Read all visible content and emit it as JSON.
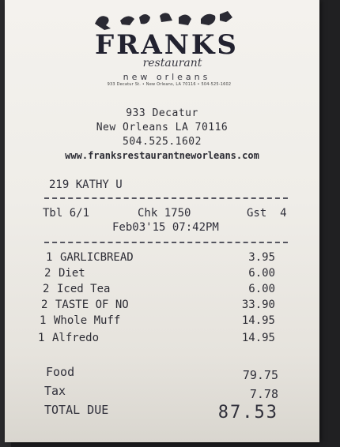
{
  "logo": {
    "name": "FRANKS",
    "sub1": "restaurant",
    "sub2": "new orleans",
    "address_line": "933 Decatur St. • New Orleans, LA 70116 • 504-525-1602"
  },
  "header": {
    "street": "933 Decatur",
    "city": "New Orleans LA 70116",
    "phone": "504.525.1602",
    "website": "www.franksrestaurantneworleans.com"
  },
  "server": "219 KATHY U",
  "ticket": {
    "table": "Tbl 6/1",
    "check": "Chk 1750",
    "guests": "Gst  4",
    "datetime": "Feb03'15 07:42PM"
  },
  "items": [
    {
      "qty": "1",
      "name": "GARLICBREAD",
      "price": "3.95"
    },
    {
      "qty": "2",
      "name": "Diet",
      "price": "6.00"
    },
    {
      "qty": "2",
      "name": "Iced Tea",
      "price": "6.00"
    },
    {
      "qty": "2",
      "name": "TASTE OF NO",
      "price": "33.90"
    },
    {
      "qty": "1",
      "name": "Whole Muff",
      "price": "14.95"
    },
    {
      "qty": "1",
      "name": "Alfredo",
      "price": "14.95"
    }
  ],
  "totals": {
    "food_label": "Food",
    "food": "79.75",
    "tax_label": "Tax",
    "tax": "7.78",
    "total_label": "TOTAL DUE",
    "total": "87.53"
  }
}
